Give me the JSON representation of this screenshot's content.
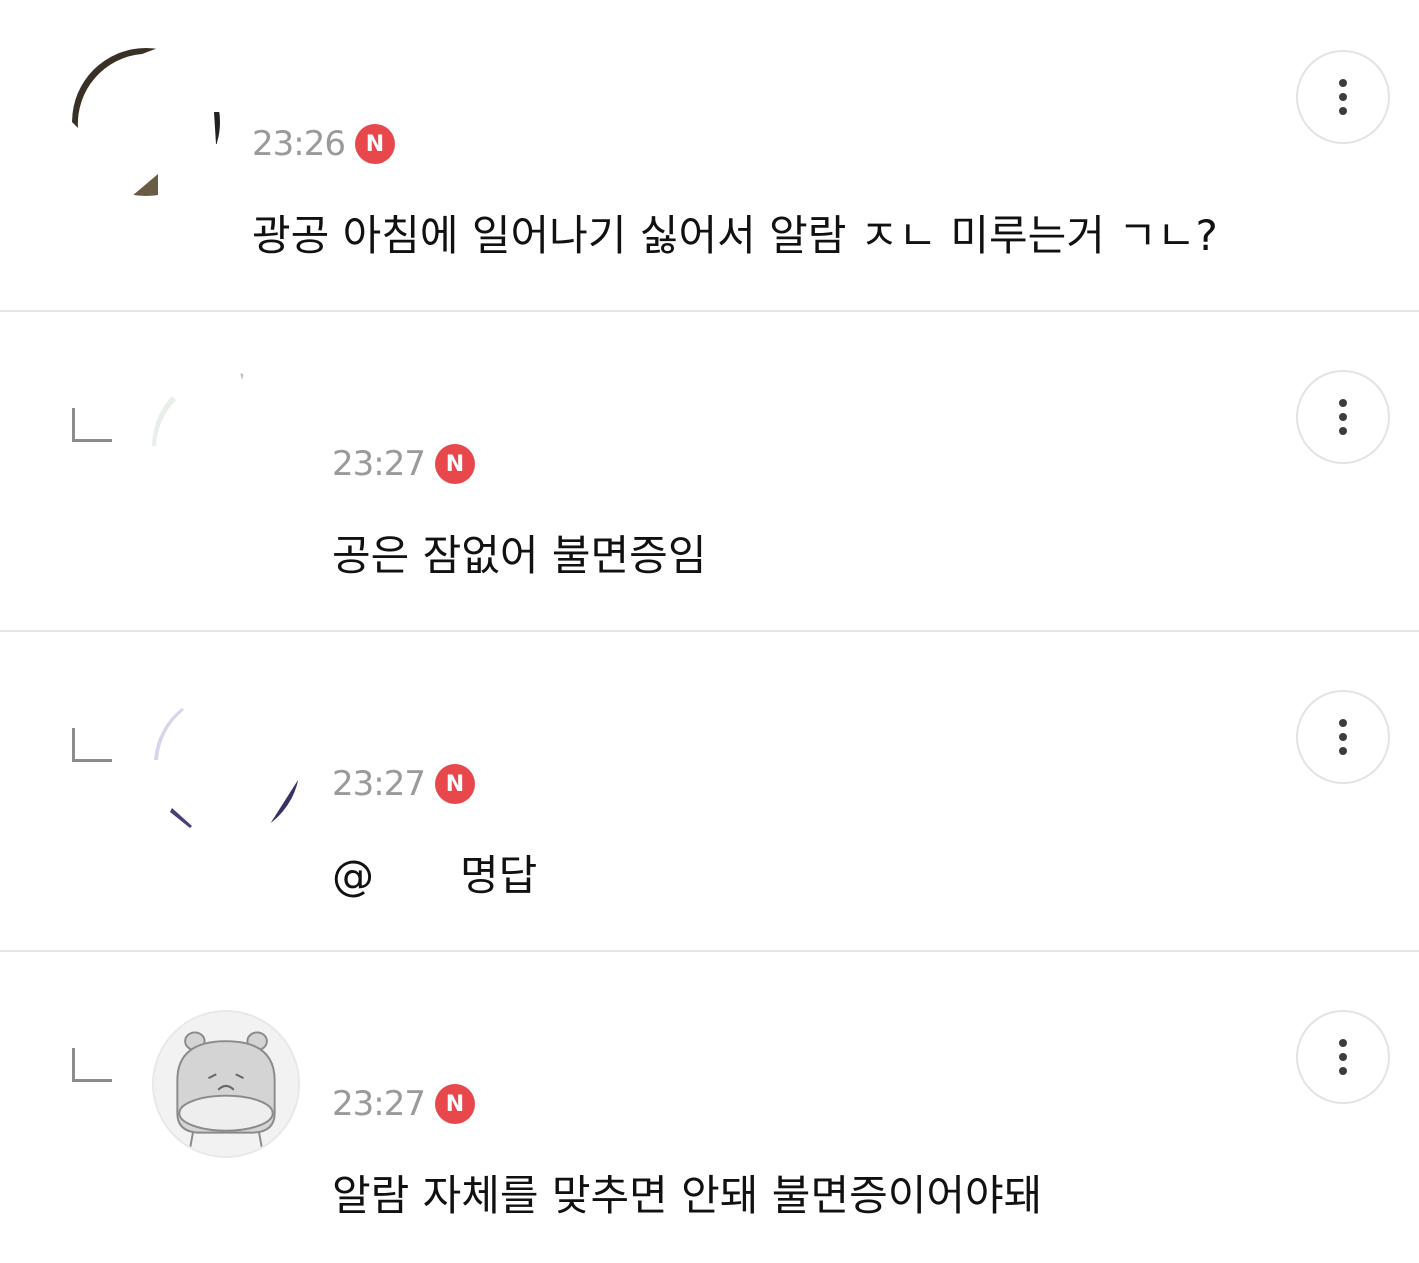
{
  "comments": [
    {
      "time": "23:26",
      "badge": "N",
      "text": "광공 아침에 일어나기 싫어서 알람 ㅈㄴ 미루는거 ㄱㄴ?",
      "is_reply": false
    },
    {
      "time": "23:27",
      "badge": "N",
      "text": "공은 잠없어 불면증임",
      "is_reply": true
    },
    {
      "time": "23:27",
      "badge": "N",
      "mention": "@",
      "text": "명답",
      "is_reply": true
    },
    {
      "time": "23:27",
      "badge": "N",
      "text": "알람 자체를 맞추면 안돼 불면증이어야돼",
      "is_reply": true
    }
  ],
  "icons": {
    "reply": "reply-arrow-icon",
    "more": "more-vertical-icon",
    "new": "new-badge-icon"
  },
  "colors": {
    "badge": "#e8474c",
    "time": "#9a9a9a",
    "text": "#111111",
    "divider": "#e6e6e6"
  }
}
